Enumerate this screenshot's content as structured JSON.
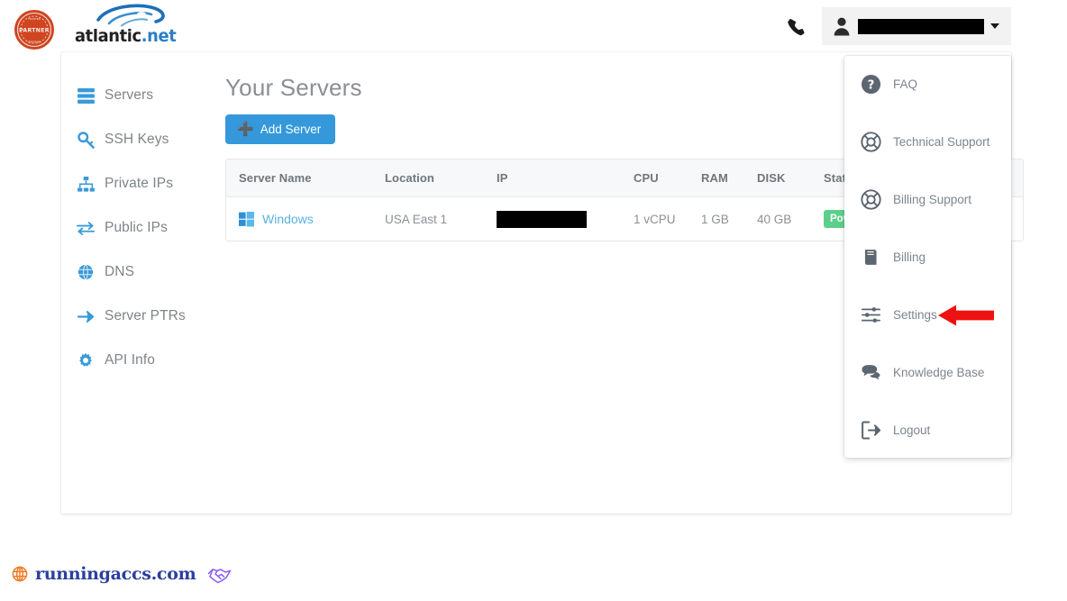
{
  "header": {
    "brand_name": "atlantic",
    "brand_tld": ".net",
    "partner_badge_text": "PARTNER",
    "phone_icon": "phone-icon",
    "user_icon": "user-icon",
    "user_name": "",
    "caret_icon": "chevron-down-icon",
    "colors": {
      "brand_blue": "#2c7fc4",
      "badge_orange": "#cf4520"
    }
  },
  "sidebar": {
    "items": [
      {
        "label": "Servers",
        "icon": "server-icon"
      },
      {
        "label": "SSH Keys",
        "icon": "key-icon"
      },
      {
        "label": "Private IPs",
        "icon": "sitemap-icon"
      },
      {
        "label": "Public IPs",
        "icon": "exchange-arrows-icon"
      },
      {
        "label": "DNS",
        "icon": "globe-icon"
      },
      {
        "label": "Server PTRs",
        "icon": "arrow-right-icon"
      },
      {
        "label": "API Info",
        "icon": "gear-icon"
      }
    ]
  },
  "main": {
    "title": "Your Servers",
    "add_server_label": "Add Server",
    "add_server_icon": "plus-icon",
    "accent_blue": "#3498db",
    "table": {
      "columns": [
        "Server Name",
        "Location",
        "IP",
        "CPU",
        "RAM",
        "DISK",
        "Status"
      ],
      "rows": [
        {
          "server_name": "Windows",
          "server_icon": "windows-logo-icon",
          "location": "USA East 1",
          "ip": "",
          "ip_redacted": true,
          "cpu": "1 vCPU",
          "ram": "1 GB",
          "disk": "40 GB",
          "status": "Powered On",
          "status_color": "#5cd08a"
        }
      ]
    }
  },
  "dropdown": {
    "items": [
      {
        "label": "FAQ",
        "icon": "question-circle-icon"
      },
      {
        "label": "Technical Support",
        "icon": "life-ring-icon"
      },
      {
        "label": "Billing Support",
        "icon": "life-ring-icon"
      },
      {
        "label": "Billing",
        "icon": "book-icon"
      },
      {
        "label": "Settings",
        "icon": "sliders-icon"
      },
      {
        "label": "Knowledge Base",
        "icon": "comments-icon"
      },
      {
        "label": "Logout",
        "icon": "sign-out-icon"
      }
    ]
  },
  "annotation": {
    "arrow_icon": "red-arrow-left-icon",
    "arrow_color": "#ee1111",
    "points_at": "Settings"
  },
  "footer": {
    "site": "runningaccs.com",
    "globe_icon": "globe-icon",
    "handshake_icon": "handshake-icon",
    "site_color": "#2b3f9e"
  }
}
